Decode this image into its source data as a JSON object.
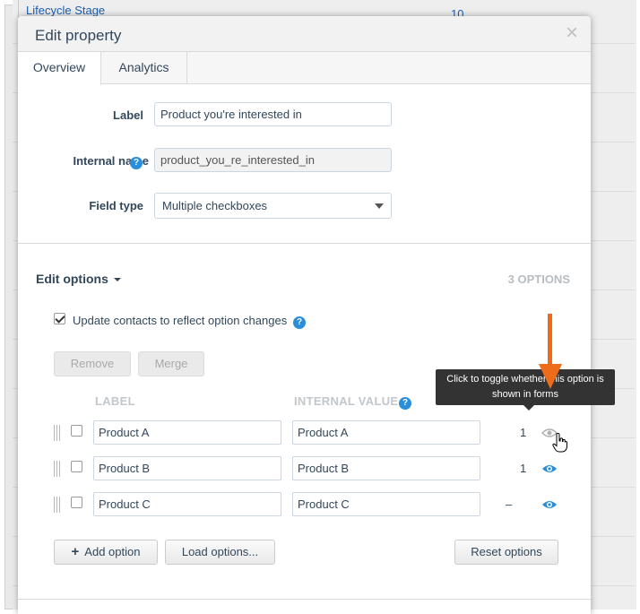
{
  "background": {
    "link_left": "Lifecycle Stage",
    "link_right": "10"
  },
  "modal": {
    "title": "Edit property",
    "close_glyph": "×"
  },
  "tabs": [
    {
      "label": "Overview",
      "active": true
    },
    {
      "label": "Analytics",
      "active": false
    }
  ],
  "form": {
    "label_label": "Label",
    "label_value": "Product you're interested in",
    "internal_name_label": "Internal name",
    "internal_name_value": "product_you_re_interested_in",
    "field_type_label": "Field type",
    "field_type_value": "Multiple checkboxes",
    "help_glyph": "?"
  },
  "options_section": {
    "title": "Edit options",
    "count_label": "3 OPTIONS",
    "update_contacts_label": "Update contacts to reflect option changes",
    "update_contacts_checked": true,
    "remove_label": "Remove",
    "merge_label": "Merge",
    "col_label": "LABEL",
    "col_internal_value": "INTERNAL VALUE",
    "rows": [
      {
        "label": "Product A",
        "internal_value": "Product A",
        "count": "1",
        "visible_in_forms": false
      },
      {
        "label": "Product B",
        "internal_value": "Product B",
        "count": "1",
        "visible_in_forms": true
      },
      {
        "label": "Product C",
        "internal_value": "Product C",
        "count": "–",
        "visible_in_forms": true
      }
    ],
    "add_option_label": "Add option",
    "add_option_glyph": "+",
    "load_options_label": "Load options...",
    "reset_options_label": "Reset options"
  },
  "tooltip": {
    "text_line1": "Click to toggle whether this option is",
    "text_line2": "shown in forms"
  },
  "colors": {
    "accent_orange": "#ee6b1c",
    "eye_blue": "#2b8ed8",
    "eye_gray": "#b0b0b0"
  }
}
